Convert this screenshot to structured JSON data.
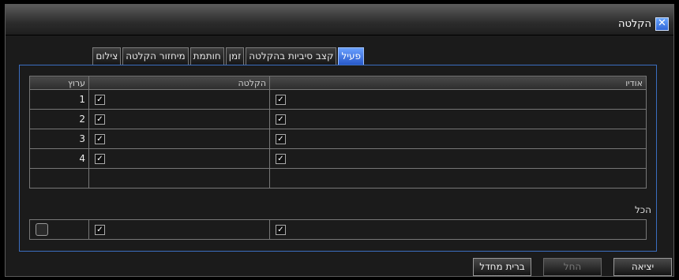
{
  "window": {
    "title": "הקלטה",
    "close_label": "✕"
  },
  "tabs": [
    {
      "label": "פעיל",
      "active": true
    },
    {
      "label": "קצב סיביות בהקלטה",
      "active": false
    },
    {
      "label": "זמן",
      "active": false
    },
    {
      "label": "חותמת",
      "active": false
    },
    {
      "label": "מיחזור הקלטה",
      "active": false
    },
    {
      "label": "צילום",
      "active": false
    }
  ],
  "table": {
    "headers": {
      "channel": "ערוץ",
      "record": "הקלטה",
      "audio": "אודיו"
    },
    "rows": [
      {
        "channel": "1",
        "record": true,
        "audio": true
      },
      {
        "channel": "2",
        "record": true,
        "audio": true
      },
      {
        "channel": "3",
        "record": true,
        "audio": true
      },
      {
        "channel": "4",
        "record": true,
        "audio": true
      }
    ]
  },
  "all_section": {
    "label": "הכל",
    "channel_checked": false,
    "record_checked": true,
    "audio_checked": true
  },
  "buttons": {
    "default_label": "ברית מחדל",
    "apply_label": "החל",
    "exit_label": "יציאה"
  },
  "colors": {
    "accent": "#3b6ec0",
    "tab_active": "#2556c8"
  }
}
